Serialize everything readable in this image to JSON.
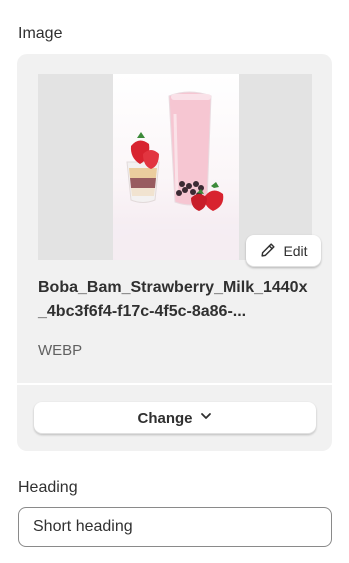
{
  "image_section": {
    "label": "Image",
    "filename": "Boba_Bam_Strawberry_Milk_1440x_4bc3f6f4-f17c-4f5c-8a86-...",
    "filetype": "WEBP",
    "edit_label": "Edit",
    "change_label": "Change",
    "preview_alt": "Strawberry milk with boba pearls and strawberries"
  },
  "heading_section": {
    "label": "Heading",
    "value": "Short heading"
  },
  "colors": {
    "card_background": "#f1f1f1",
    "preview_background": "#e3e3e3",
    "text": "#303030",
    "muted_text": "#616161",
    "milk_pink": "#f6c6d2",
    "strawberry_red": "#d8232f"
  },
  "icons": {
    "edit": "pencil-icon",
    "change": "chevron-down-icon"
  }
}
